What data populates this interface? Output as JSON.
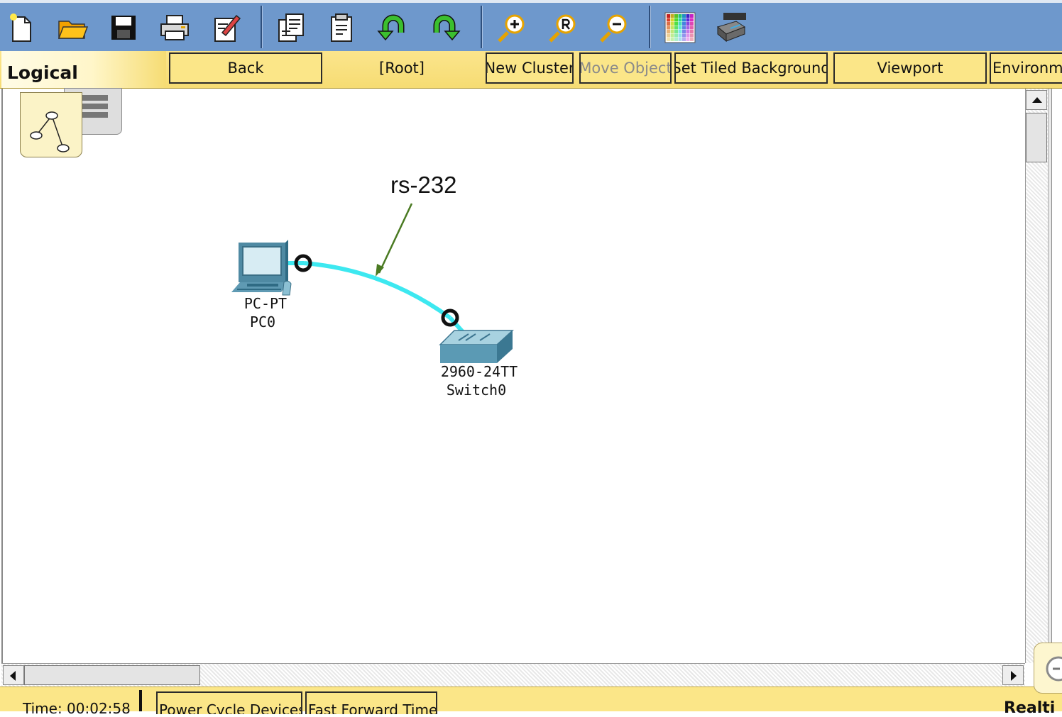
{
  "toolbar": {
    "icons": [
      "new-file",
      "open-folder",
      "save",
      "print",
      "edit",
      "copy",
      "paste",
      "undo",
      "redo",
      "zoom-in",
      "zoom-reset",
      "zoom-out",
      "palette",
      "custom-device"
    ]
  },
  "logical_bar": {
    "tab_label": "Logical",
    "buttons": {
      "back": "Back",
      "root": "[Root]",
      "new_cluster": "New Cluster",
      "move_object": "Move Object",
      "set_tiled_background": "Set Tiled Background",
      "viewport": "Viewport",
      "environment": "Environme"
    }
  },
  "workspace": {
    "annotation": "rs-232",
    "devices": [
      {
        "model": "PC-PT",
        "name": "PC0"
      },
      {
        "model": "2960-24TT",
        "name": "Switch0"
      }
    ],
    "cable_color": "#3de8f0",
    "annotation_arrow_color": "#4a7a22"
  },
  "status": {
    "time": "Time: 00:02:58",
    "power_cycle": "Power Cycle Devices",
    "fast_forward": "Fast Forward Time",
    "realtime": "Realti"
  }
}
